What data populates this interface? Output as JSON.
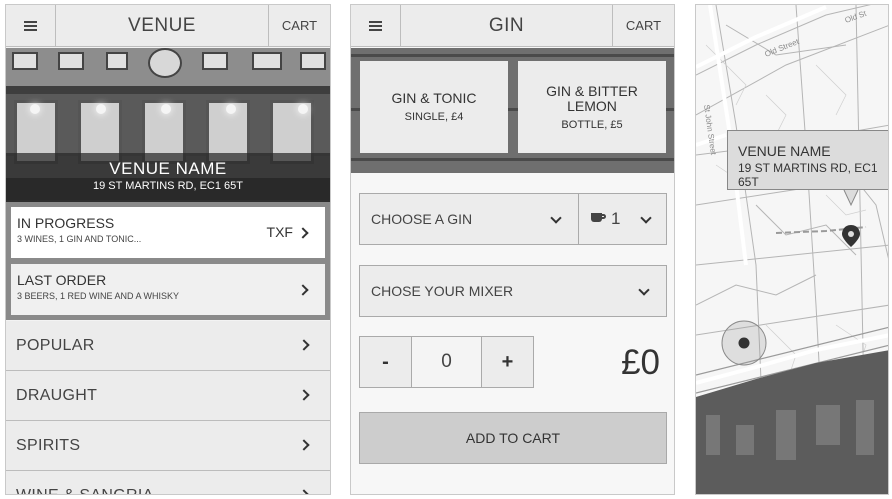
{
  "venue_screen": {
    "header": {
      "menu_icon": "hamburger-icon",
      "title": "VENUE",
      "cart": "CART"
    },
    "hero": {
      "name": "VENUE NAME",
      "address": "19 ST MARTINS RD, EC1 65T"
    },
    "in_progress": {
      "title": "IN PROGRESS",
      "subtitle": "3 WINES, 1 GIN AND TONIC...",
      "code": "TXF"
    },
    "last_order": {
      "title": "LAST ORDER",
      "subtitle": "3 BEERS, 1 RED WINE AND A WHISKY"
    },
    "categories": [
      "POPULAR",
      "DRAUGHT",
      "SPIRITS",
      "WINE & SANGRIA"
    ]
  },
  "gin_screen": {
    "header": {
      "menu_icon": "hamburger-icon",
      "title": "GIN",
      "cart": "CART"
    },
    "tiles": [
      {
        "name": "GIN & TONIC",
        "detail": "SINGLE, £4"
      },
      {
        "name": "GIN & BITTER LEMON",
        "detail": "BOTTLE, £5"
      }
    ],
    "choose_gin": "CHOOSE A GIN",
    "measure_icon": "cup-icon",
    "measure_value": "1",
    "mixer": "CHOSE YOUR MIXER",
    "stepper": {
      "minus": "-",
      "value": "0",
      "plus": "+"
    },
    "price": "£0",
    "add_to_cart": "ADD TO CART"
  },
  "map_screen": {
    "callout": {
      "name": "VENUE NAME",
      "address": "19 ST MARTINS RD, EC1 65T"
    },
    "street_labels": [
      "Old St",
      "Old Street",
      "St John Street"
    ],
    "pin_icon": "map-pin-icon",
    "location_icon": "current-location-icon"
  }
}
